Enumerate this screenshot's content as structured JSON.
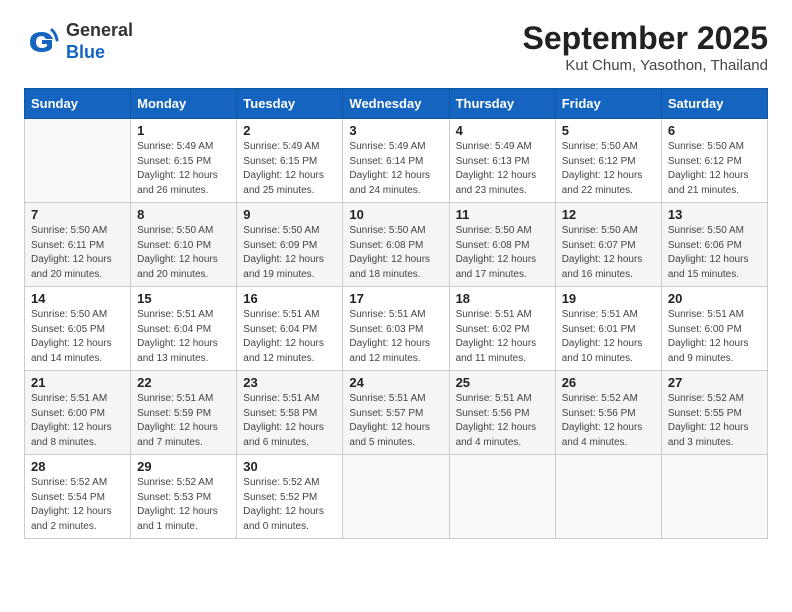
{
  "header": {
    "logo_general": "General",
    "logo_blue": "Blue",
    "month": "September 2025",
    "location": "Kut Chum, Yasothon, Thailand"
  },
  "weekdays": [
    "Sunday",
    "Monday",
    "Tuesday",
    "Wednesday",
    "Thursday",
    "Friday",
    "Saturday"
  ],
  "weeks": [
    [
      {
        "day": "",
        "info": ""
      },
      {
        "day": "1",
        "info": "Sunrise: 5:49 AM\nSunset: 6:15 PM\nDaylight: 12 hours\nand 26 minutes."
      },
      {
        "day": "2",
        "info": "Sunrise: 5:49 AM\nSunset: 6:15 PM\nDaylight: 12 hours\nand 25 minutes."
      },
      {
        "day": "3",
        "info": "Sunrise: 5:49 AM\nSunset: 6:14 PM\nDaylight: 12 hours\nand 24 minutes."
      },
      {
        "day": "4",
        "info": "Sunrise: 5:49 AM\nSunset: 6:13 PM\nDaylight: 12 hours\nand 23 minutes."
      },
      {
        "day": "5",
        "info": "Sunrise: 5:50 AM\nSunset: 6:12 PM\nDaylight: 12 hours\nand 22 minutes."
      },
      {
        "day": "6",
        "info": "Sunrise: 5:50 AM\nSunset: 6:12 PM\nDaylight: 12 hours\nand 21 minutes."
      }
    ],
    [
      {
        "day": "7",
        "info": "Sunrise: 5:50 AM\nSunset: 6:11 PM\nDaylight: 12 hours\nand 20 minutes."
      },
      {
        "day": "8",
        "info": "Sunrise: 5:50 AM\nSunset: 6:10 PM\nDaylight: 12 hours\nand 20 minutes."
      },
      {
        "day": "9",
        "info": "Sunrise: 5:50 AM\nSunset: 6:09 PM\nDaylight: 12 hours\nand 19 minutes."
      },
      {
        "day": "10",
        "info": "Sunrise: 5:50 AM\nSunset: 6:08 PM\nDaylight: 12 hours\nand 18 minutes."
      },
      {
        "day": "11",
        "info": "Sunrise: 5:50 AM\nSunset: 6:08 PM\nDaylight: 12 hours\nand 17 minutes."
      },
      {
        "day": "12",
        "info": "Sunrise: 5:50 AM\nSunset: 6:07 PM\nDaylight: 12 hours\nand 16 minutes."
      },
      {
        "day": "13",
        "info": "Sunrise: 5:50 AM\nSunset: 6:06 PM\nDaylight: 12 hours\nand 15 minutes."
      }
    ],
    [
      {
        "day": "14",
        "info": "Sunrise: 5:50 AM\nSunset: 6:05 PM\nDaylight: 12 hours\nand 14 minutes."
      },
      {
        "day": "15",
        "info": "Sunrise: 5:51 AM\nSunset: 6:04 PM\nDaylight: 12 hours\nand 13 minutes."
      },
      {
        "day": "16",
        "info": "Sunrise: 5:51 AM\nSunset: 6:04 PM\nDaylight: 12 hours\nand 12 minutes."
      },
      {
        "day": "17",
        "info": "Sunrise: 5:51 AM\nSunset: 6:03 PM\nDaylight: 12 hours\nand 12 minutes."
      },
      {
        "day": "18",
        "info": "Sunrise: 5:51 AM\nSunset: 6:02 PM\nDaylight: 12 hours\nand 11 minutes."
      },
      {
        "day": "19",
        "info": "Sunrise: 5:51 AM\nSunset: 6:01 PM\nDaylight: 12 hours\nand 10 minutes."
      },
      {
        "day": "20",
        "info": "Sunrise: 5:51 AM\nSunset: 6:00 PM\nDaylight: 12 hours\nand 9 minutes."
      }
    ],
    [
      {
        "day": "21",
        "info": "Sunrise: 5:51 AM\nSunset: 6:00 PM\nDaylight: 12 hours\nand 8 minutes."
      },
      {
        "day": "22",
        "info": "Sunrise: 5:51 AM\nSunset: 5:59 PM\nDaylight: 12 hours\nand 7 minutes."
      },
      {
        "day": "23",
        "info": "Sunrise: 5:51 AM\nSunset: 5:58 PM\nDaylight: 12 hours\nand 6 minutes."
      },
      {
        "day": "24",
        "info": "Sunrise: 5:51 AM\nSunset: 5:57 PM\nDaylight: 12 hours\nand 5 minutes."
      },
      {
        "day": "25",
        "info": "Sunrise: 5:51 AM\nSunset: 5:56 PM\nDaylight: 12 hours\nand 4 minutes."
      },
      {
        "day": "26",
        "info": "Sunrise: 5:52 AM\nSunset: 5:56 PM\nDaylight: 12 hours\nand 4 minutes."
      },
      {
        "day": "27",
        "info": "Sunrise: 5:52 AM\nSunset: 5:55 PM\nDaylight: 12 hours\nand 3 minutes."
      }
    ],
    [
      {
        "day": "28",
        "info": "Sunrise: 5:52 AM\nSunset: 5:54 PM\nDaylight: 12 hours\nand 2 minutes."
      },
      {
        "day": "29",
        "info": "Sunrise: 5:52 AM\nSunset: 5:53 PM\nDaylight: 12 hours\nand 1 minute."
      },
      {
        "day": "30",
        "info": "Sunrise: 5:52 AM\nSunset: 5:52 PM\nDaylight: 12 hours\nand 0 minutes."
      },
      {
        "day": "",
        "info": ""
      },
      {
        "day": "",
        "info": ""
      },
      {
        "day": "",
        "info": ""
      },
      {
        "day": "",
        "info": ""
      }
    ]
  ]
}
